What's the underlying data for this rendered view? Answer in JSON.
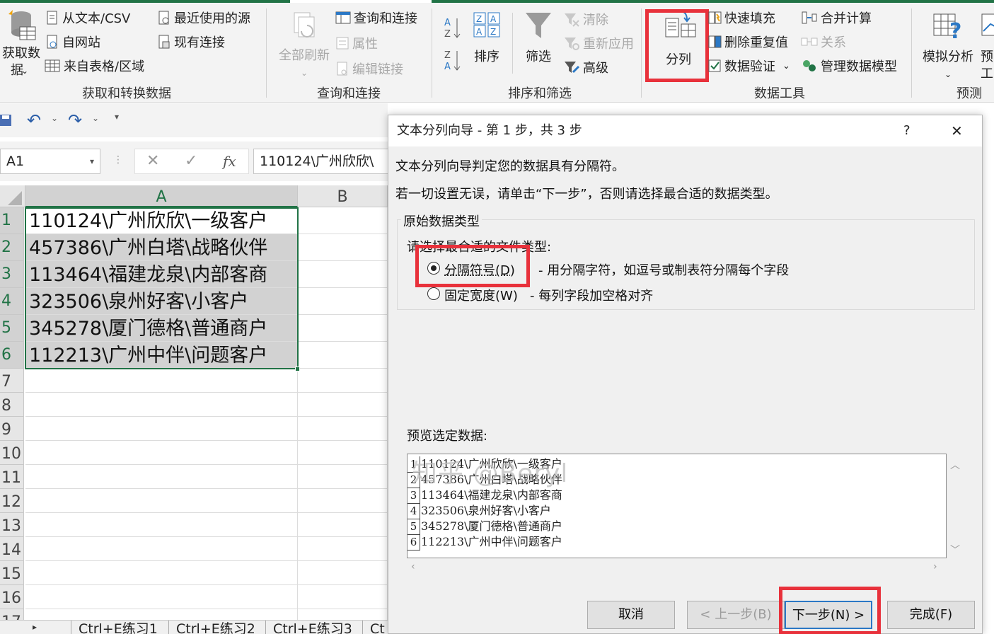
{
  "ribbon": {
    "get_transform": {
      "get_data_line1": "获取数",
      "get_data_line2": "据",
      "from_text_csv": "从文本/CSV",
      "from_web": "自网站",
      "from_table": "来自表格/区域",
      "recent_sources": "最近使用的源",
      "existing_connections": "现有连接",
      "group_label": "获取和转换数据"
    },
    "queries": {
      "refresh_all": "全部刷新",
      "queries_connections": "查询和连接",
      "properties": "属性",
      "edit_links": "编辑链接",
      "group_label": "查询和连接"
    },
    "sort_filter": {
      "sort": "排序",
      "filter": "筛选",
      "clear": "清除",
      "reapply": "重新应用",
      "advanced": "高级",
      "group_label": "排序和筛选"
    },
    "data_tools": {
      "text_to_columns": "分列",
      "flash_fill": "快速填充",
      "remove_duplicates": "删除重复值",
      "data_validation": "数据验证",
      "consolidate": "合并计算",
      "relationships": "关系",
      "manage_data_model": "管理数据模型",
      "group_label": "数据工具"
    },
    "forecast": {
      "what_if": "模拟分析",
      "forecast_sheet_line1": "预",
      "forecast_sheet_line2": "工",
      "group_label": "预测"
    }
  },
  "formula_bar": {
    "name_box": "A1",
    "fx": "fx",
    "value": "110124\\广州欣欣\\"
  },
  "grid": {
    "columns": [
      "A",
      "B"
    ],
    "row_numbers": [
      "1",
      "2",
      "3",
      "4",
      "5",
      "6",
      "7",
      "8",
      "9",
      "10",
      "11",
      "12",
      "13",
      "14",
      "15",
      "16",
      "17"
    ],
    "cells": [
      "110124\\广州欣欣\\一级客户",
      "457386\\广州白塔\\战略伙伴",
      "113464\\福建龙泉\\内部客商",
      "323506\\泉州好客\\小客户",
      "345278\\厦门德格\\普通商户",
      "112213\\广州中伴\\问题客户"
    ]
  },
  "sheet_tabs": [
    "Ctrl+E练习1",
    "Ctrl+E练习2",
    "Ctrl+E练习3",
    "Ct"
  ],
  "dialog": {
    "title": "文本分列向导 - 第 1 步，共 3 步",
    "help": "?",
    "close": "✕",
    "intro1": "文本分列向导判定您的数据具有分隔符。",
    "intro2": "若一切设置无误，请单击“下一步”，否则请选择最合适的数据类型。",
    "group_title": "原始数据类型",
    "choose_label": "请选择最合适的文件类型:",
    "option_delimited": "分隔符号(D)",
    "option_delimited_desc": "- 用分隔字符，如逗号或制表符分隔每个字段",
    "option_fixed": "固定宽度(W)",
    "option_fixed_desc": "- 每列字段加空格对齐",
    "selected_option": "delimited",
    "preview_label": "预览选定数据:",
    "preview_rows": [
      {
        "n": "1",
        "text": "110124\\广州欣欣\\一级客户"
      },
      {
        "n": "2",
        "text": "457386\\广州白塔\\战略伙伴"
      },
      {
        "n": "3",
        "text": "113464\\福建龙泉\\内部客商"
      },
      {
        "n": "4",
        "text": "323506\\泉州好客\\小客户"
      },
      {
        "n": "5",
        "text": "345278\\厦门德格\\普通商户"
      },
      {
        "n": "6",
        "text": "112213\\广州中伴\\问题客户"
      }
    ],
    "buttons": {
      "cancel": "取消",
      "back": "< 上一步(B)",
      "next": "下一步(N) >",
      "finish": "完成(F)"
    }
  },
  "watermark": "知乎 @Beryl",
  "colors": {
    "excel_green": "#217346",
    "highlight_red": "#e8313b",
    "selection_gray": "#d2d2d2"
  }
}
